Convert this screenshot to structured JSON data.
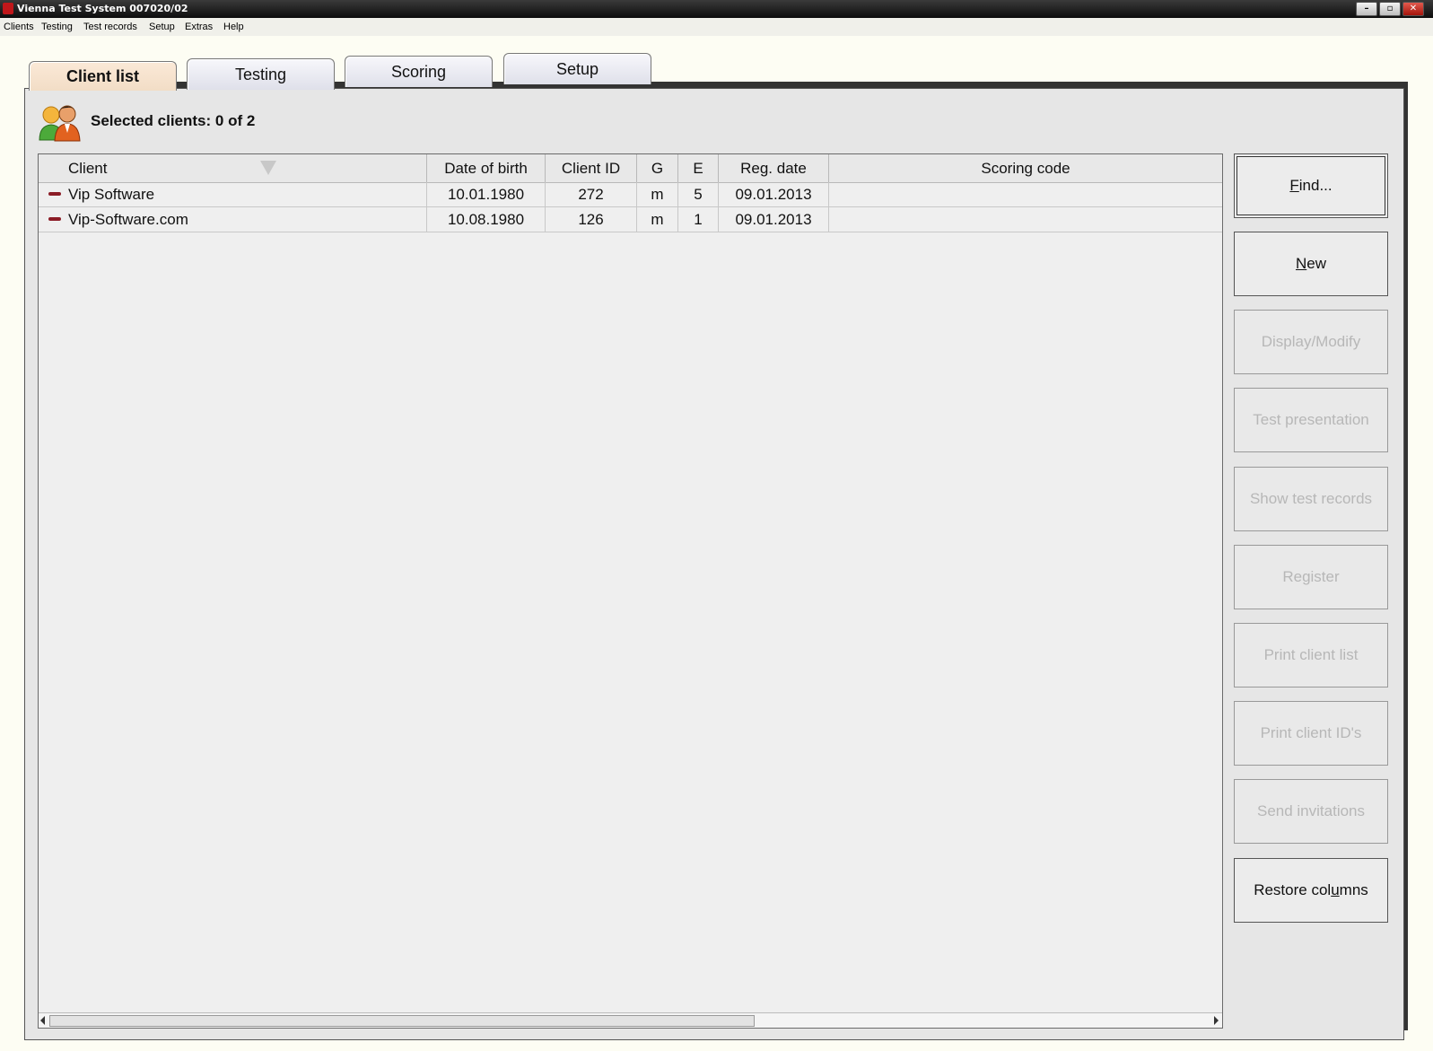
{
  "window": {
    "title": "Vienna Test System 007020/02",
    "min_label": "–",
    "max_label": "▫",
    "close_label": "✕"
  },
  "menu": [
    "Clients",
    "Testing",
    "Test records",
    "Setup",
    "Extras",
    "Help"
  ],
  "tabs": [
    {
      "label": "Client list",
      "active": true
    },
    {
      "label": "Testing",
      "active": false
    },
    {
      "label": "Scoring",
      "active": false
    },
    {
      "label": "Setup",
      "active": false
    }
  ],
  "selection": {
    "label": "Selected clients: 0 of 2"
  },
  "table": {
    "columns": [
      "Client",
      "Date of birth",
      "Client ID",
      "G",
      "E",
      "Reg. date",
      "Scoring code"
    ],
    "rows": [
      [
        "Vip Software",
        "10.01.1980",
        "272",
        "m",
        "5",
        "09.01.2013",
        ""
      ],
      [
        "Vip-Software.com",
        "10.08.1980",
        "126",
        "m",
        "1",
        "09.01.2013",
        ""
      ]
    ]
  },
  "buttons": {
    "find": {
      "label": "Find...",
      "accel": "F",
      "rest": "ind...",
      "enabled": true
    },
    "new": {
      "label": "New",
      "accel": "N",
      "rest": "ew",
      "enabled": true
    },
    "display_modify": {
      "label": "Display/Modify",
      "enabled": false
    },
    "test_presentation": {
      "label": "Test presentation",
      "enabled": false
    },
    "show_test_records": {
      "label": "Show test records",
      "enabled": false
    },
    "register": {
      "label": "Register",
      "enabled": false
    },
    "print_client_list": {
      "label": "Print client list",
      "enabled": false
    },
    "print_client_ids": {
      "label": "Print client ID's",
      "enabled": false
    },
    "send_invitations": {
      "label": "Send invitations",
      "enabled": false
    },
    "restore_columns": {
      "label": "Restore columns",
      "pre": "Restore col",
      "accel": "u",
      "post": "mns",
      "enabled": true
    }
  },
  "colors": {
    "app_bg": "#fdfdf3",
    "active_tab": "#f2ddc6",
    "row_marker": "#8b1c26",
    "disabled_text": "#b7b7b7"
  }
}
